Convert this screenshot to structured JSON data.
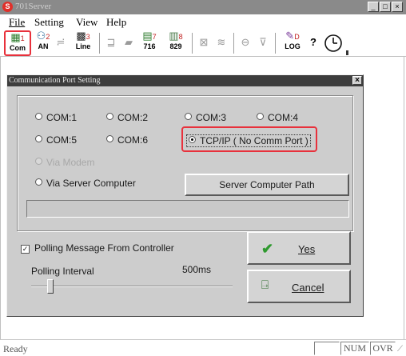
{
  "window": {
    "title": "701Server",
    "app_icon_glyph": "S"
  },
  "menu": [
    "File",
    "Setting",
    "View",
    "Help"
  ],
  "toolbar": {
    "items": [
      {
        "icon": "comm-port-icon",
        "number": "1",
        "label": "Com"
      },
      {
        "icon": "lan-icon",
        "number": "2",
        "label": "AN"
      },
      {
        "icon": "line-icon",
        "number": "3",
        "label": "Line"
      },
      {
        "icon": "controller-716-icon",
        "number": "7",
        "label": "716"
      },
      {
        "icon": "controller-829-icon",
        "number": "8",
        "label": "829"
      },
      {
        "icon": "log-icon",
        "number": "D",
        "label": "LOG"
      }
    ]
  },
  "dialog": {
    "title": "Communication Port Setting",
    "ports": [
      "COM:1",
      "COM:2",
      "COM:3",
      "COM:4",
      "COM:5",
      "COM:6"
    ],
    "tcpip_label": "TCP/IP ( No Comm Port )",
    "via_modem_label": "Via Modem",
    "via_server_label": "Via Server Computer",
    "server_path_button": "Server Computer Path",
    "polling_checkbox_label": "Polling Message From Controller",
    "polling_interval_label": "Polling Interval",
    "polling_interval_value": "500ms",
    "yes_label": "Yes",
    "cancel_label": "Cancel"
  },
  "status": {
    "ready": "Ready",
    "num": "NUM",
    "ovr": "OVR"
  },
  "colors": {
    "highlight": "#e8313c",
    "check_green": "#2f9a2f"
  }
}
